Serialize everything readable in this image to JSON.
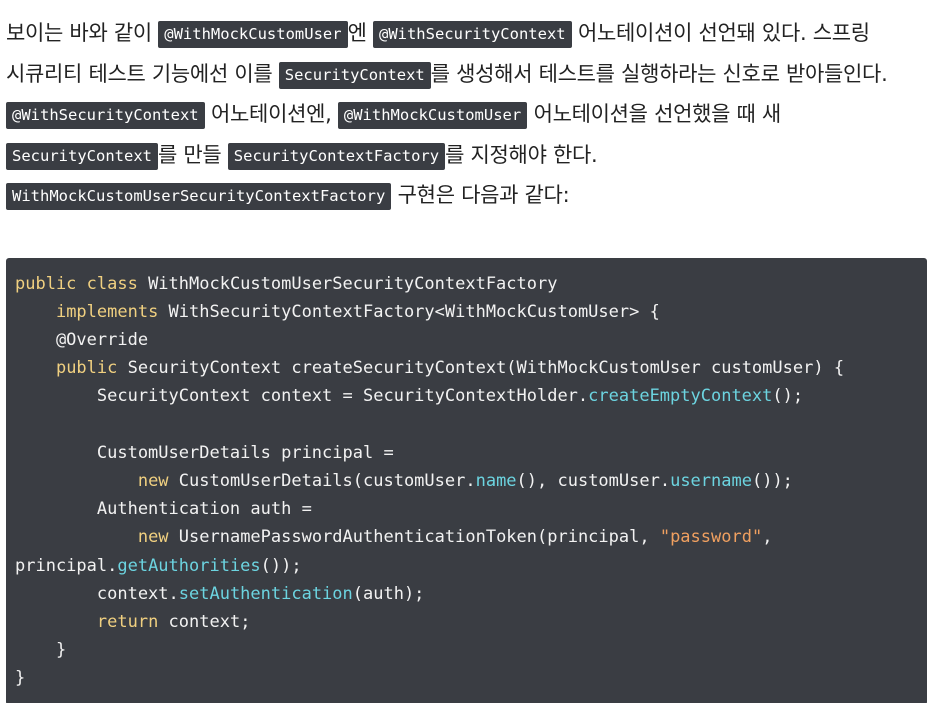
{
  "paragraph": {
    "t1": "보이는 바와 같이 ",
    "c1": "@WithMockCustomUser",
    "t2": "엔 ",
    "c2": "@WithSecurityContext",
    "t3": " 어노테이션이 선언돼 있다. 스프링 시큐리티 테스트 기능에선 이를 ",
    "c3": "SecurityContext",
    "t4": "를 생성해서 테스트를 실행하라는 신호로 받아들인다. ",
    "c4": "@WithSecurityContext",
    "t5": " 어노테이션엔, ",
    "c5": "@WithMockCustomUser",
    "t6": " 어노테이션을 선언했을 때 새 ",
    "c6": "SecurityContext",
    "t7": "를 만들 ",
    "c7": "SecurityContextFactory",
    "t8": "를 지정해야 한다. ",
    "c8": "WithMockCustomUserSecurityContextFactory",
    "t9": " 구현은 다음과 같다:"
  },
  "code": {
    "l1_kw": "public class",
    "l1_rest": " WithMockCustomUserSecurityContextFactory",
    "l2_indent": "    ",
    "l2_kw": "implements",
    "l2_rest": " WithSecurityContextFactory<WithMockCustomUser> {",
    "l3": "    @Override",
    "l4_indent": "    ",
    "l4_kw": "public",
    "l4_rest": " SecurityContext createSecurityContext(WithMockCustomUser customUser) {",
    "l5_a": "        SecurityContext context = SecurityContextHolder.",
    "l5_fn": "createEmptyContext",
    "l5_b": "();",
    "l6": "",
    "l7": "        CustomUserDetails principal =",
    "l8_indent": "            ",
    "l8_kw": "new",
    "l8_a": " CustomUserDetails(customUser.",
    "l8_fn1": "name",
    "l8_b": "(), customUser.",
    "l8_fn2": "username",
    "l8_c": "());",
    "l9": "        Authentication auth =",
    "l10_indent": "            ",
    "l10_kw": "new",
    "l10_a": " UsernamePasswordAuthenticationToken(principal, ",
    "l10_str": "\"password\"",
    "l10_b": ",",
    "l11_a": "principal.",
    "l11_fn": "getAuthorities",
    "l11_b": "());",
    "l12_a": "        context.",
    "l12_fn": "setAuthentication",
    "l12_b": "(auth);",
    "l13_indent": "        ",
    "l13_kw": "return",
    "l13_rest": " context;",
    "l14": "    }",
    "l15": "}"
  },
  "colors": {
    "code_background": "#3a3d43",
    "keyword": "#f0d080",
    "method": "#6cd4e0",
    "string": "#f0a060"
  }
}
